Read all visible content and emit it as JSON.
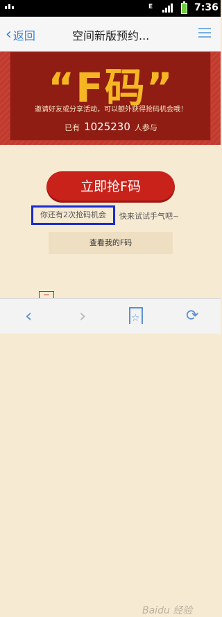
{
  "status_bar": {
    "network_label": "E",
    "time": "7:36"
  },
  "nav": {
    "back_label": "返回",
    "title": "空间新版预约..."
  },
  "banner": {
    "headline": "“F码”",
    "invite_text": "邀请好友或分享活动，可以额外获得抢码机会哦！",
    "participants_prefix": "已有",
    "participants_count": "1025230",
    "participants_suffix": "人参与"
  },
  "actions": {
    "grab_button_label": "立即抢F码",
    "chances_text": "你还有2次抢码机会",
    "hint_text": "快来试试手气吧~",
    "view_button_label": "查看我的F码"
  },
  "toolbar": {
    "back_glyph": "‹",
    "forward_glyph": "›",
    "refresh_glyph": "⟳"
  },
  "watermark": {
    "text": "Baidu 经验"
  }
}
